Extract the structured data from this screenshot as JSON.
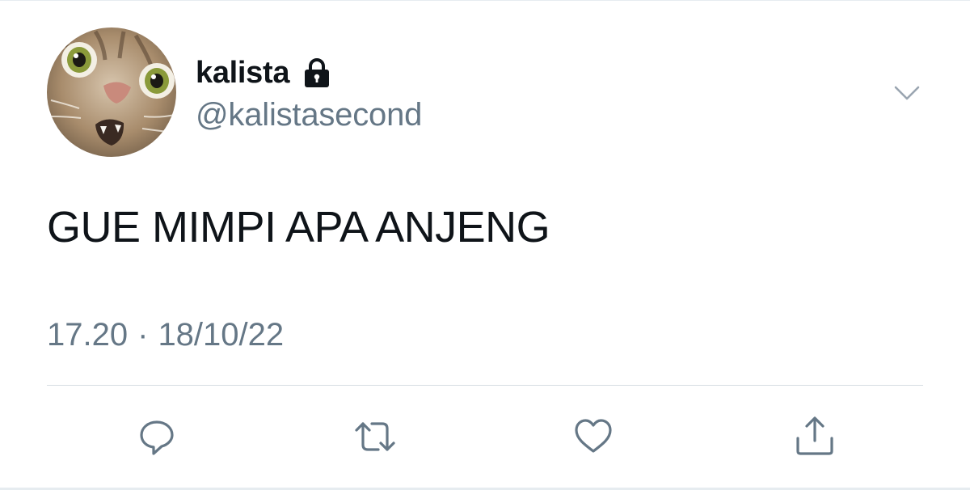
{
  "tweet": {
    "author": {
      "display_name": "kalista",
      "handle": "@kalistasecond",
      "protected_icon": "lock-icon",
      "avatar": "cat-face-avatar"
    },
    "text": "GUE MIMPI APA ANJENG",
    "time": "17.20",
    "separator": "·",
    "date": "18/10/22"
  },
  "actions": [
    {
      "name": "reply",
      "icon": "speech-bubble-icon"
    },
    {
      "name": "retweet",
      "icon": "retweet-arrows-icon"
    },
    {
      "name": "like",
      "icon": "heart-icon"
    },
    {
      "name": "share",
      "icon": "share-upload-icon"
    }
  ],
  "menu": {
    "icon": "chevron-down-icon"
  },
  "colors": {
    "text_primary": "#0f1419",
    "text_secondary": "#657786",
    "icon": "#657786",
    "divider": "#d7dde2"
  }
}
